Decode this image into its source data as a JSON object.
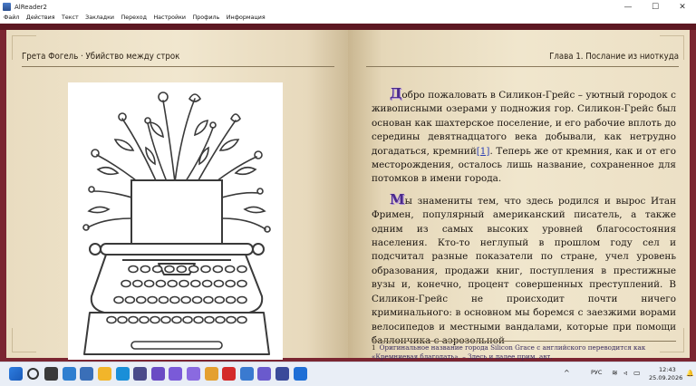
{
  "window": {
    "title": "AlReader2",
    "controls": [
      "—",
      "☐",
      "✕"
    ]
  },
  "menu": [
    "Файл",
    "Действия",
    "Текст",
    "Закладки",
    "Переход",
    "Настройки",
    "Профиль",
    "Информация"
  ],
  "book": {
    "left_header": "Грета Фогель · Убийство между строк",
    "right_header": "Глава 1. Послание из ниоткуда",
    "paragraphs": [
      {
        "dropcap": "Д",
        "before": "обро пожаловать в Силикон-Грейс – уютный городок с живописными озерами у подножия гор. Силикон-Грейс был основан как шахтерское поселение, и его рабочие вплоть до середины девятнадцатого века добывали, как нетрудно догадаться, кремний",
        "ref": "[1]",
        "after": ". Теперь же от кремния, как и от его месторождения, осталось лишь название, сохраненное для потомков в имени города."
      },
      {
        "dropcap": "М",
        "before": "ы знамениты тем, что здесь родился и вырос Итан Фримен, популярный американский писатель, а также одним из самых высоких уровней благосостояния населения. Кто-то неглупый в прошлом году сел и подсчитал разные показатели по стране, учел уровень образования, продажи книг, поступления в престижные вузы и, конечно, процент совершенных преступлений. В Силикон-Грейс не происходит почти ничего криминального: в основном мы боремся с заезжими ворами велосипедов и местными вандалами, которые при помощи баллончика с аэрозольной",
        "ref": "",
        "after": ""
      }
    ],
    "footnote": {
      "num": "1",
      "text": "Оригинальное название города Silicon Grace с английского переводится как «Кремниевая благодать». – Здесь и далее прим. авт."
    }
  },
  "taskbar": {
    "lang": "РУС",
    "time": "12:43",
    "date": "25.09.2026",
    "icons": [
      "windows-start-icon",
      "search-icon",
      "task-view-icon",
      "widgets-icon",
      "app-icon",
      "file-explorer-icon",
      "edge-icon",
      "app-icon",
      "app-icon",
      "app-icon",
      "app-icon",
      "chrome-icon",
      "opera-icon",
      "app-icon",
      "app-icon",
      "app-icon",
      "alreader-icon"
    ]
  },
  "colors": {
    "frame": "#7b2531",
    "page": "#ede2c9",
    "dropcap": "#4a2a8a",
    "link": "#2b3fb4"
  }
}
